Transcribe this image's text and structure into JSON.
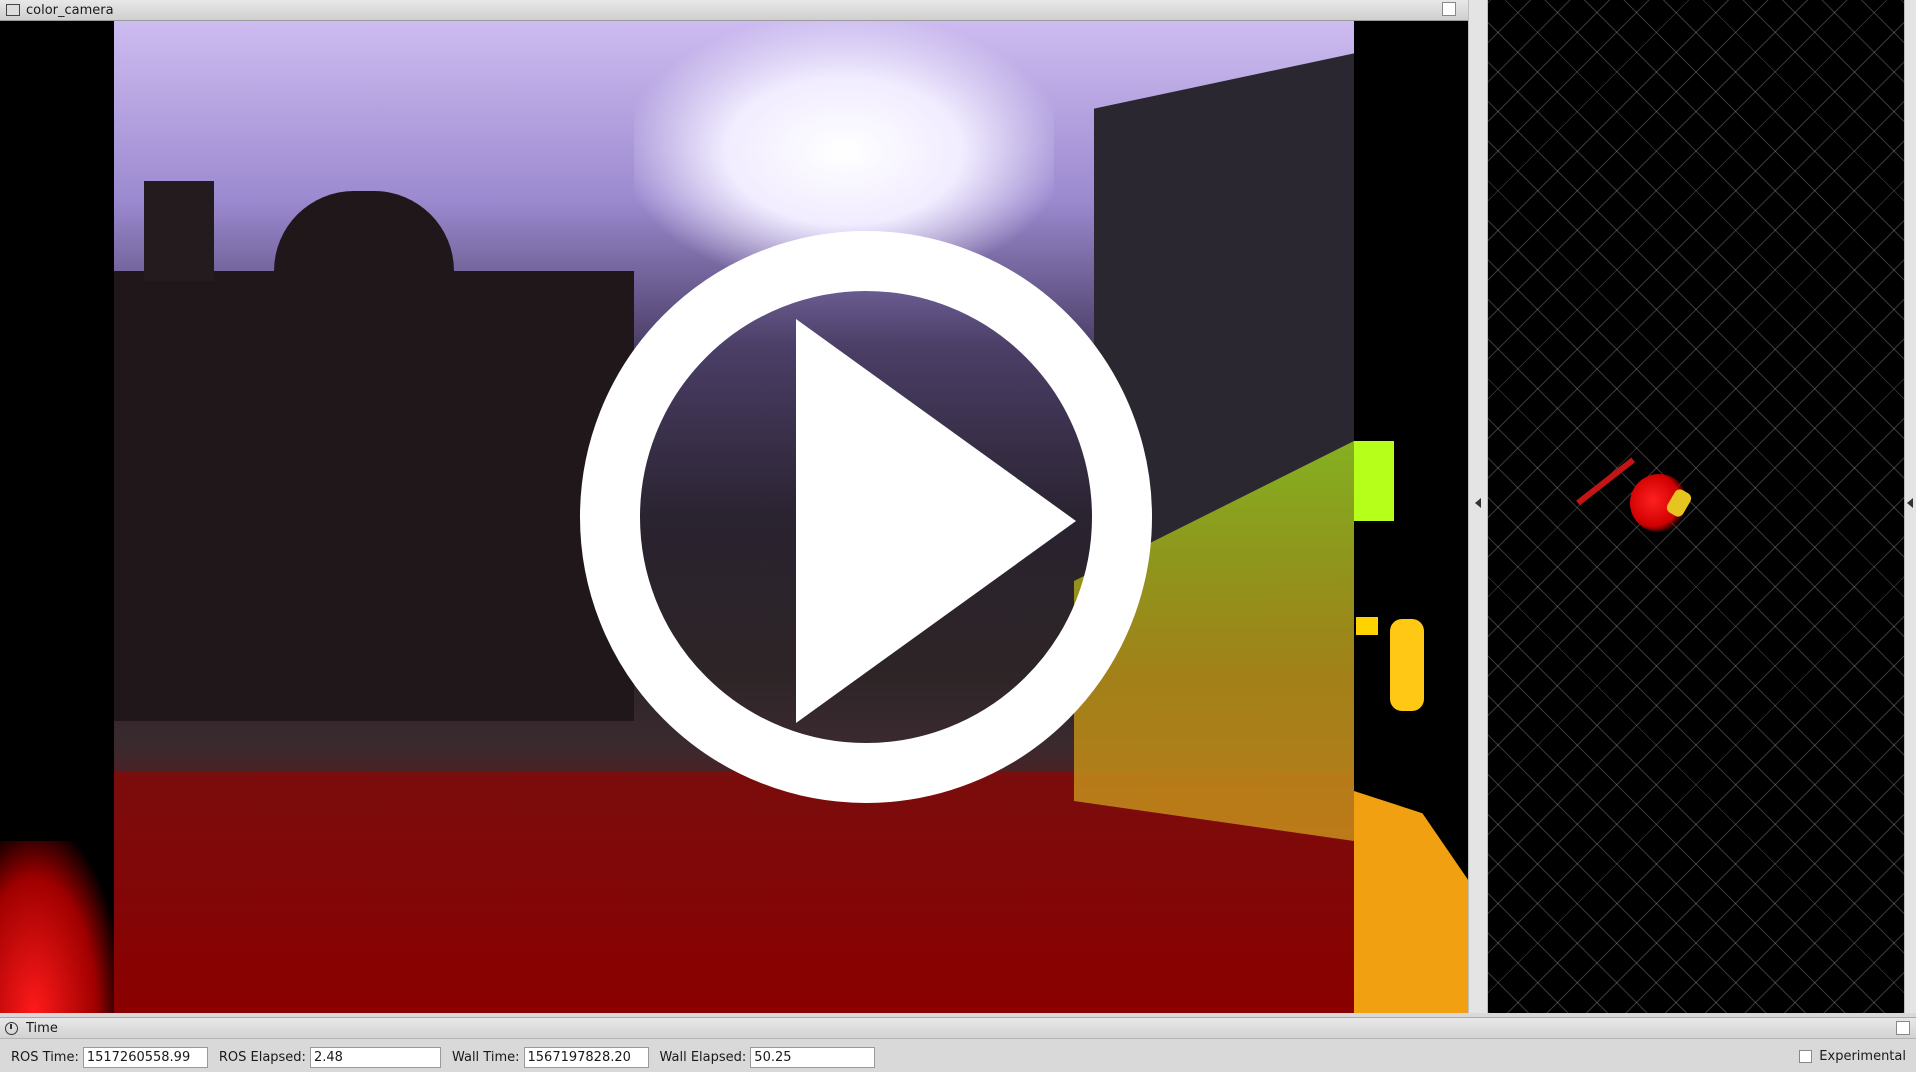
{
  "camera_panel": {
    "title": "color_camera"
  },
  "time_panel": {
    "title": "Time",
    "ros_time_label": "ROS Time:",
    "ros_time_value": "1517260558.99",
    "ros_elapsed_label": "ROS Elapsed:",
    "ros_elapsed_value": "2.48",
    "wall_time_label": "Wall Time:",
    "wall_time_value": "1567197828.20",
    "wall_elapsed_label": "Wall Elapsed:",
    "wall_elapsed_value": "50.25",
    "experimental_label": "Experimental",
    "experimental_checked": false
  },
  "icons": {
    "camera_window": "window-icon",
    "time_panel": "clock-icon",
    "overlay": "play-icon",
    "collapse_left": "collapse-arrow-icon",
    "collapse_right": "collapse-arrow-icon"
  }
}
